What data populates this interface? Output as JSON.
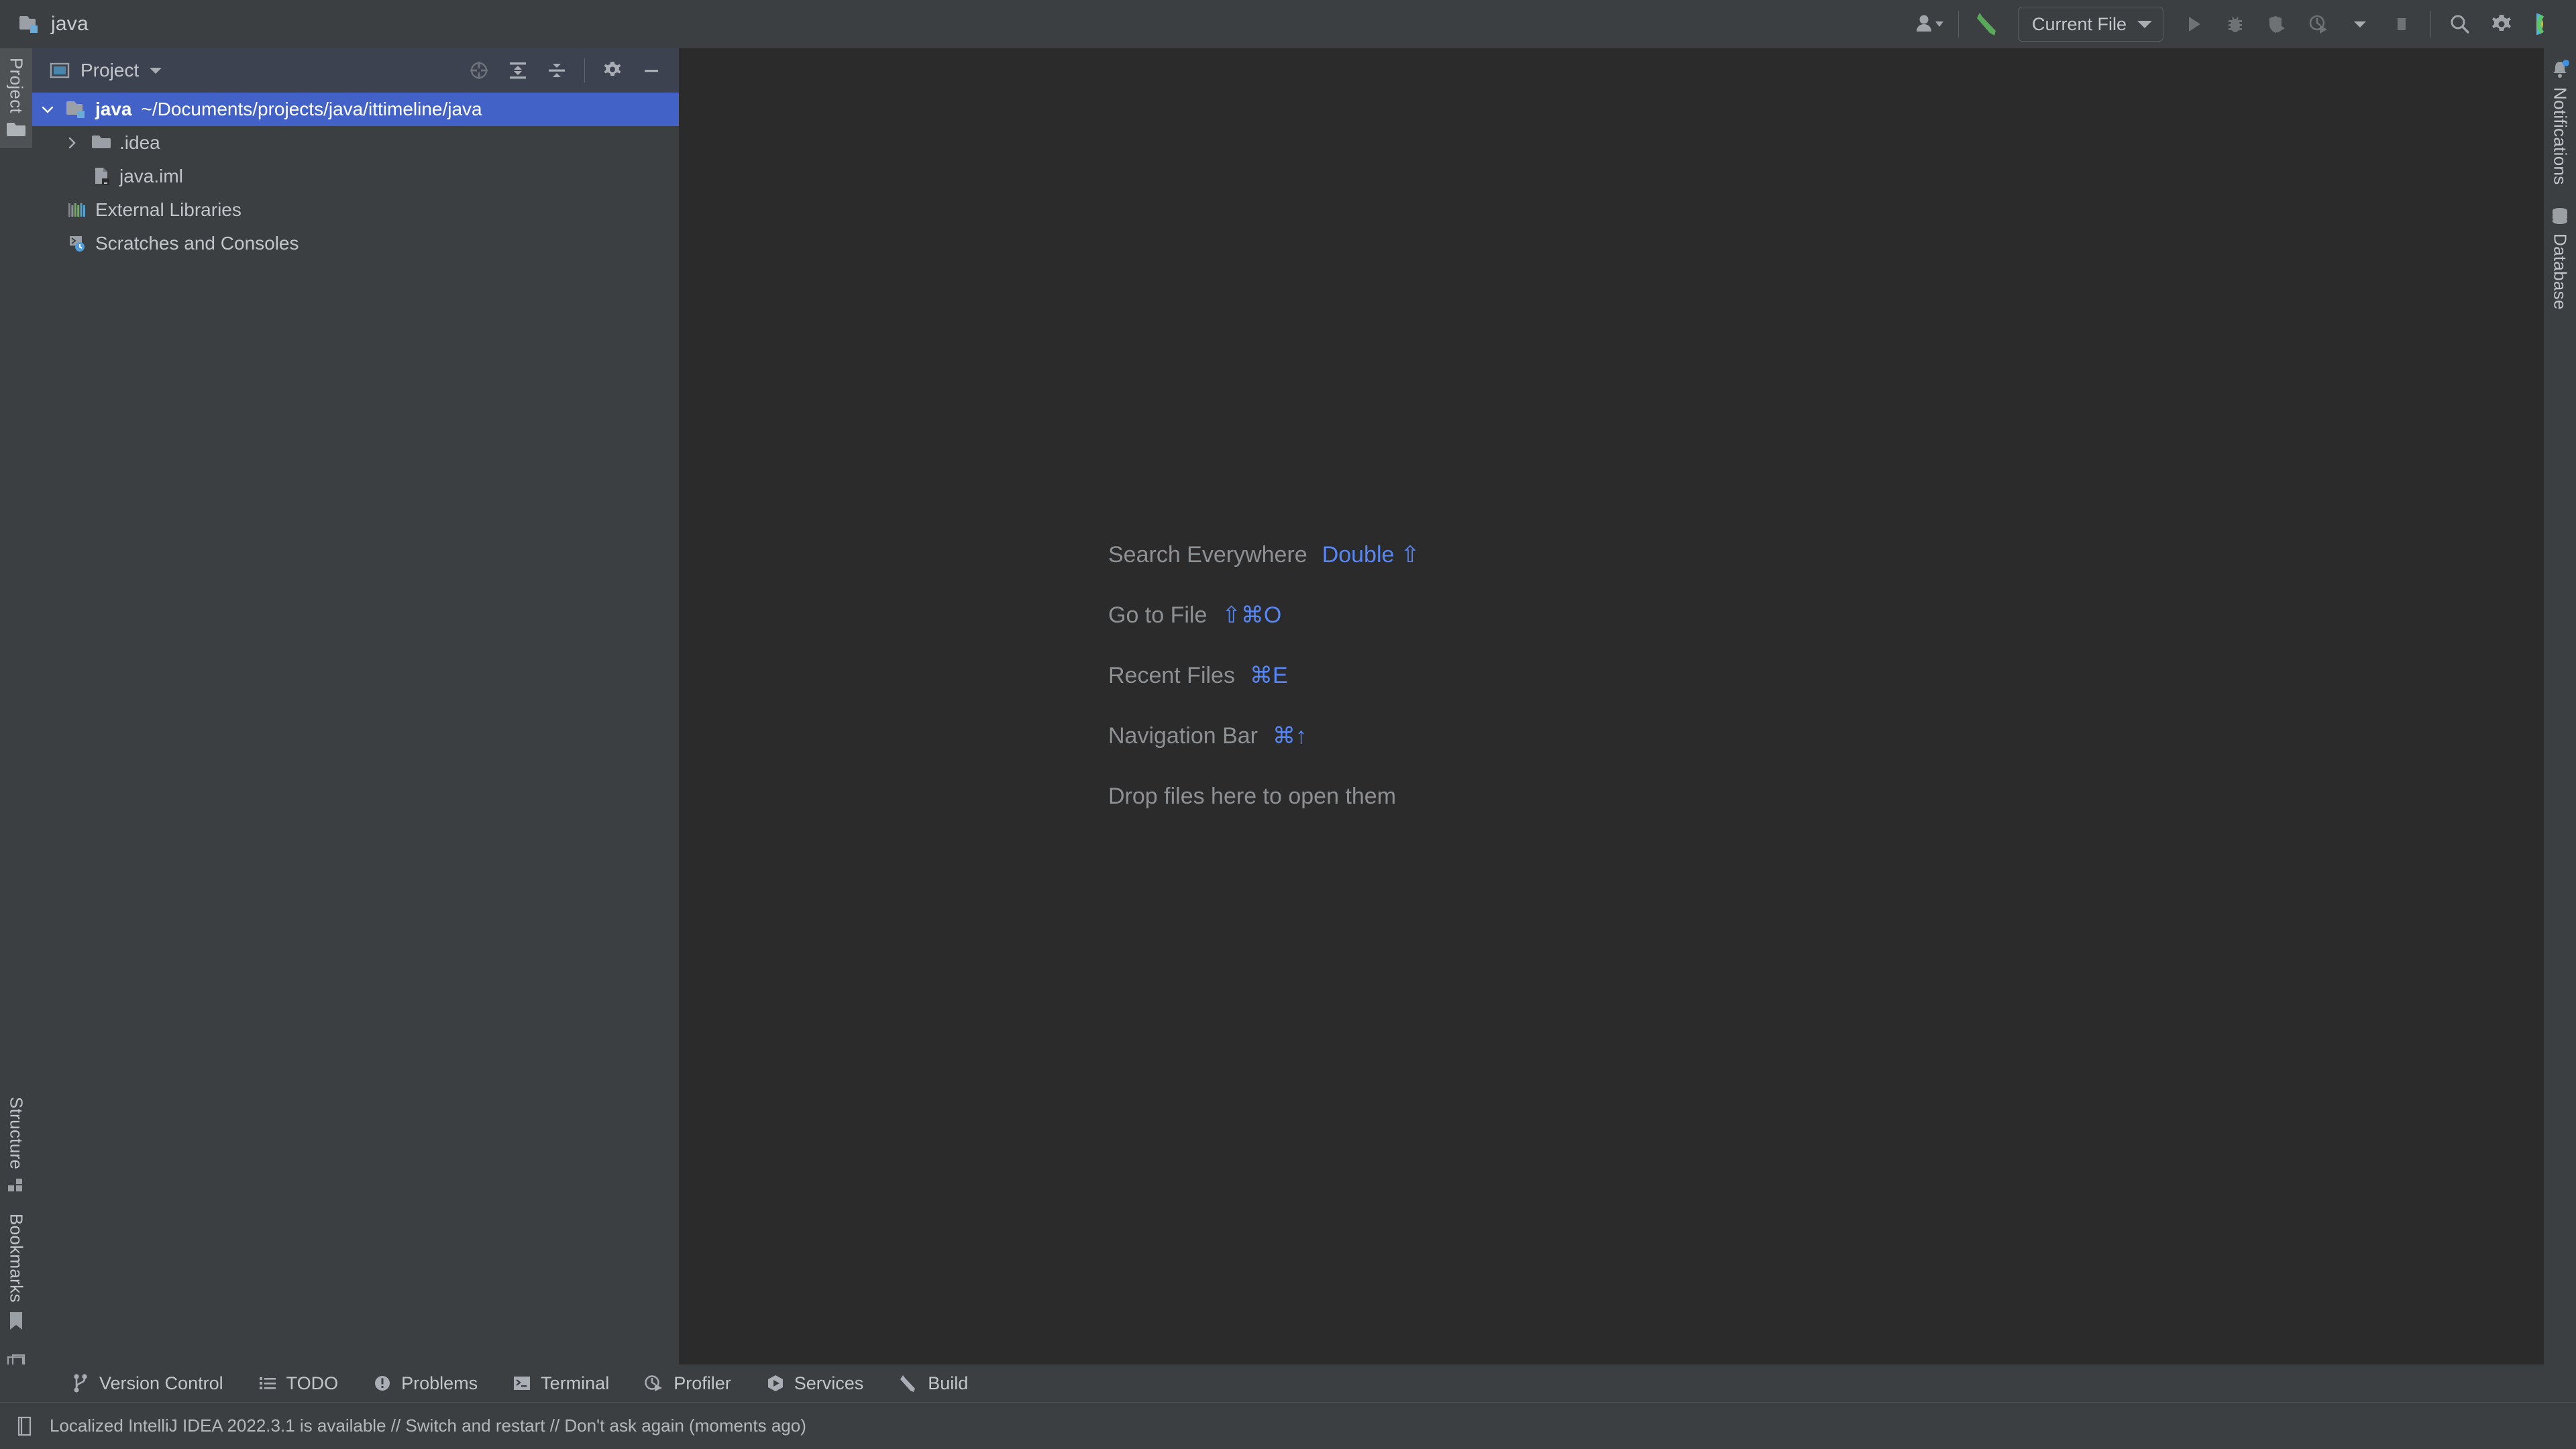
{
  "window": {
    "title": "java",
    "project_icon": "module-folder-icon"
  },
  "toolbar": {
    "items": [
      {
        "name": "user-account",
        "icon": "user-icon",
        "label": ""
      },
      {
        "name": "build-project",
        "icon": "hammer-icon",
        "label": ""
      }
    ],
    "run_config": {
      "label": "Current File",
      "icon": "chevron-down-icon"
    },
    "actions": [
      {
        "name": "run-button",
        "icon": "play-icon"
      },
      {
        "name": "debug-button",
        "icon": "bug-icon"
      },
      {
        "name": "run-with-coverage-button",
        "icon": "shield-run-icon"
      },
      {
        "name": "profile-button",
        "icon": "clock-run-icon"
      },
      {
        "name": "stop-button",
        "icon": "stop-icon"
      },
      {
        "name": "search-everywhere-button",
        "icon": "search-icon"
      },
      {
        "name": "settings-button",
        "icon": "gear-icon"
      },
      {
        "name": "ide-avatar",
        "icon": "intellij-logo-icon"
      }
    ]
  },
  "left_strip": {
    "top_items": [
      {
        "label": "Project",
        "icon": "folder-icon",
        "active": true
      }
    ],
    "bottom_items": [
      {
        "label": "Structure",
        "icon": "structure-icon",
        "active": false
      },
      {
        "label": "Bookmarks",
        "icon": "bookmark-icon",
        "active": false
      }
    ],
    "widget": {
      "name": "layout-widget",
      "icon": "window-layout-icon"
    }
  },
  "right_strip": {
    "items": [
      {
        "label": "Notifications",
        "icon": "bell-icon",
        "badge": true
      },
      {
        "label": "Database",
        "icon": "database-icon",
        "badge": false
      }
    ]
  },
  "project_panel": {
    "title": "Project",
    "title_icon": "project-view-icon",
    "dropdown_icon": "chevron-down-icon",
    "actions": [
      {
        "name": "select-opened-file-button",
        "icon": "crosshair-icon"
      },
      {
        "name": "expand-all-button",
        "icon": "expand-all-icon"
      },
      {
        "name": "collapse-all-button",
        "icon": "collapse-all-icon"
      },
      {
        "name": "panel-options-button",
        "icon": "gear-icon"
      },
      {
        "name": "hide-panel-button",
        "icon": "minimize-icon"
      }
    ],
    "tree": [
      {
        "name": "java",
        "path": "~/Documents/projects/java/ittimeline/java",
        "icon": "module-folder-icon",
        "arrow": "expanded",
        "indent": 0,
        "selected": true,
        "bold": true
      },
      {
        "name": ".idea",
        "path": "",
        "icon": "folder-icon",
        "arrow": "collapsed",
        "indent": 1,
        "selected": false,
        "bold": false
      },
      {
        "name": "java.iml",
        "path": "",
        "icon": "iml-file-icon",
        "arrow": "none",
        "indent": 1,
        "selected": false,
        "bold": false
      },
      {
        "name": "External Libraries",
        "path": "",
        "icon": "libraries-icon",
        "arrow": "none",
        "indent": 0,
        "selected": false,
        "bold": false
      },
      {
        "name": "Scratches and Consoles",
        "path": "",
        "icon": "scratches-icon",
        "arrow": "none",
        "indent": 0,
        "selected": false,
        "bold": false
      }
    ]
  },
  "editor": {
    "hints": [
      {
        "label": "Search Everywhere",
        "shortcut": "Double ⇧"
      },
      {
        "label": "Go to File",
        "shortcut": "⇧⌘O"
      },
      {
        "label": "Recent Files",
        "shortcut": "⌘E"
      },
      {
        "label": "Navigation Bar",
        "shortcut": "⌘↑"
      },
      {
        "label": "Drop files here to open them",
        "shortcut": ""
      }
    ]
  },
  "bottom_tools": [
    {
      "label": "Version Control",
      "icon": "branch-icon"
    },
    {
      "label": "TODO",
      "icon": "list-icon"
    },
    {
      "label": "Problems",
      "icon": "exclamation-circle-icon"
    },
    {
      "label": "Terminal",
      "icon": "terminal-icon"
    },
    {
      "label": "Profiler",
      "icon": "clock-run-icon"
    },
    {
      "label": "Services",
      "icon": "services-icon"
    },
    {
      "label": "Build",
      "icon": "hammer-icon"
    }
  ],
  "statusbar": {
    "icon": "notification-doc-icon",
    "message": "Localized IntelliJ IDEA 2022.3.1 is available // Switch and restart // Don't ask again (moments ago)"
  },
  "colors": {
    "titlebar_bg": "#3c3f41",
    "editor_bg": "#2b2b2b",
    "panel_header_bg": "#3c4250",
    "selection_blue": "#4262c8",
    "accent_link": "#5786f5",
    "text_primary": "#c2c5c9",
    "text_muted": "#8e9194",
    "icon_gray": "#a0a5aa",
    "badge_blue": "#3d90e3",
    "green": "#5aa85a"
  }
}
